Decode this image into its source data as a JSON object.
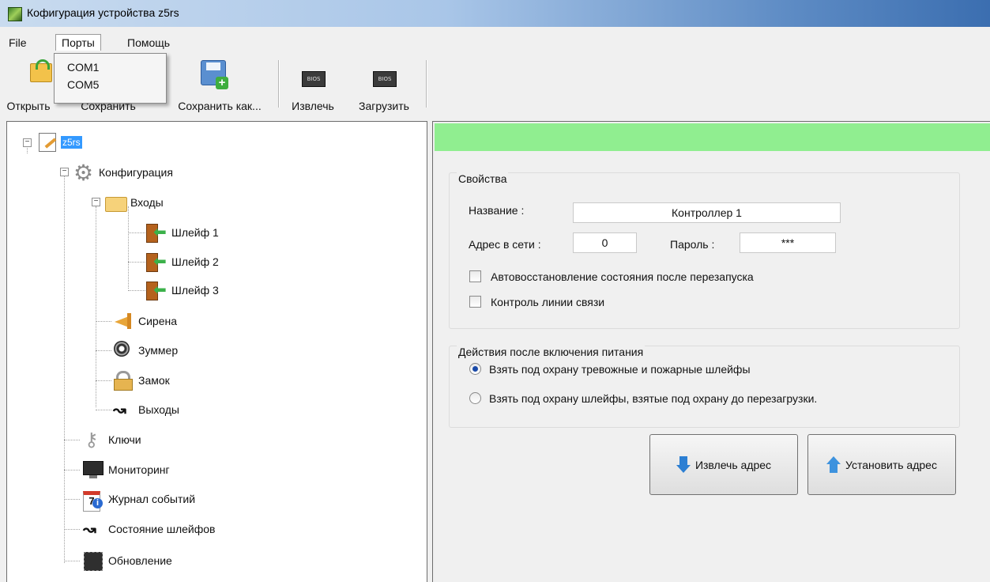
{
  "window": {
    "title": "Кофигурация устройства z5rs"
  },
  "menu": {
    "file": "File",
    "ports": "Порты",
    "help": "Помощь"
  },
  "ports_dropdown": [
    "COM1",
    "COM5"
  ],
  "toolbar": {
    "open": "Открыть",
    "save": "Сохранить",
    "save_as": "Сохранить как...",
    "extract": "Извлечь",
    "load": "Загрузить",
    "bios_icon_text": "BIOS"
  },
  "tree": {
    "root": "z5rs",
    "config": "Конфигурация",
    "inputs": "Входы",
    "shleif1": "Шлейф 1",
    "shleif2": "Шлейф 2",
    "shleif3": "Шлейф 3",
    "siren": "Сирена",
    "buzzer": "Зуммер",
    "lock": "Замок",
    "outputs": "Выходы",
    "keys": "Ключи",
    "monitoring": "Мониторинг",
    "event_log": "Журнал событий",
    "loop_state": "Состояние шлейфов",
    "update": "Обновление"
  },
  "properties": {
    "group_title": "Свойства",
    "name_label": "Название :",
    "name_value": "Контроллер 1",
    "address_label": "Адрес в сети :",
    "address_value": "0",
    "password_label": "Пароль :",
    "password_value": "***",
    "auto_restore_label": "Автовосстановление состояния после перезапуска",
    "link_control_label": "Контроль линии связи"
  },
  "power_actions": {
    "group_title": "Действия после включения питания",
    "option1": "Взять под охрану тревожные и пожарные шлейфы",
    "option2": "Взять под охрану шлейфы, взятые под охрану до перезагрузки.",
    "selected": 1
  },
  "buttons": {
    "extract_address": "Извлечь адрес",
    "set_address": "Установить адрес"
  },
  "colors": {
    "status_bar": "#90ee90",
    "selection": "#3399ff"
  }
}
